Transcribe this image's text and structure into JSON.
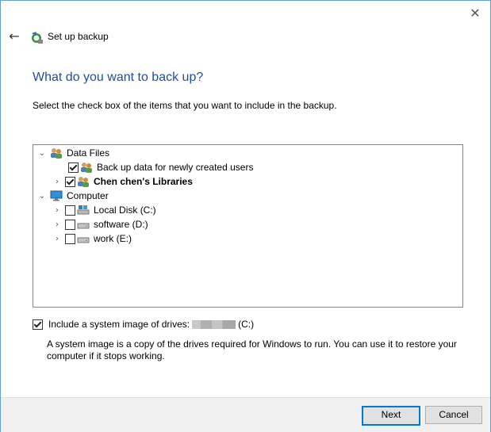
{
  "window": {
    "title": "Set up backup"
  },
  "page": {
    "heading": "What do you want to back up?",
    "instruction": "Select the check box of the items that you want to include in the backup."
  },
  "tree": {
    "data_files": {
      "label": "Data Files",
      "children": [
        {
          "label": "Back up data for newly created users",
          "checked": true
        },
        {
          "label": "Chen chen's Libraries",
          "checked": true
        }
      ]
    },
    "computer": {
      "label": "Computer",
      "children": [
        {
          "label": "Local Disk (C:)",
          "checked": false
        },
        {
          "label": "software (D:)",
          "checked": false
        },
        {
          "label": "work (E:)",
          "checked": false
        }
      ]
    }
  },
  "system_image": {
    "checked": true,
    "label": "Include a system image of drives:",
    "drive": "(C:)",
    "description": "A system image is a copy of the drives required for Windows to run. You can use it to restore your computer if it stops working."
  },
  "buttons": {
    "next": "Next",
    "cancel": "Cancel"
  },
  "icons": {
    "close": "close-icon",
    "back": "back-arrow-icon",
    "app": "backup-icon",
    "users": "users-icon",
    "computer": "computer-icon",
    "drive": "drive-icon"
  }
}
